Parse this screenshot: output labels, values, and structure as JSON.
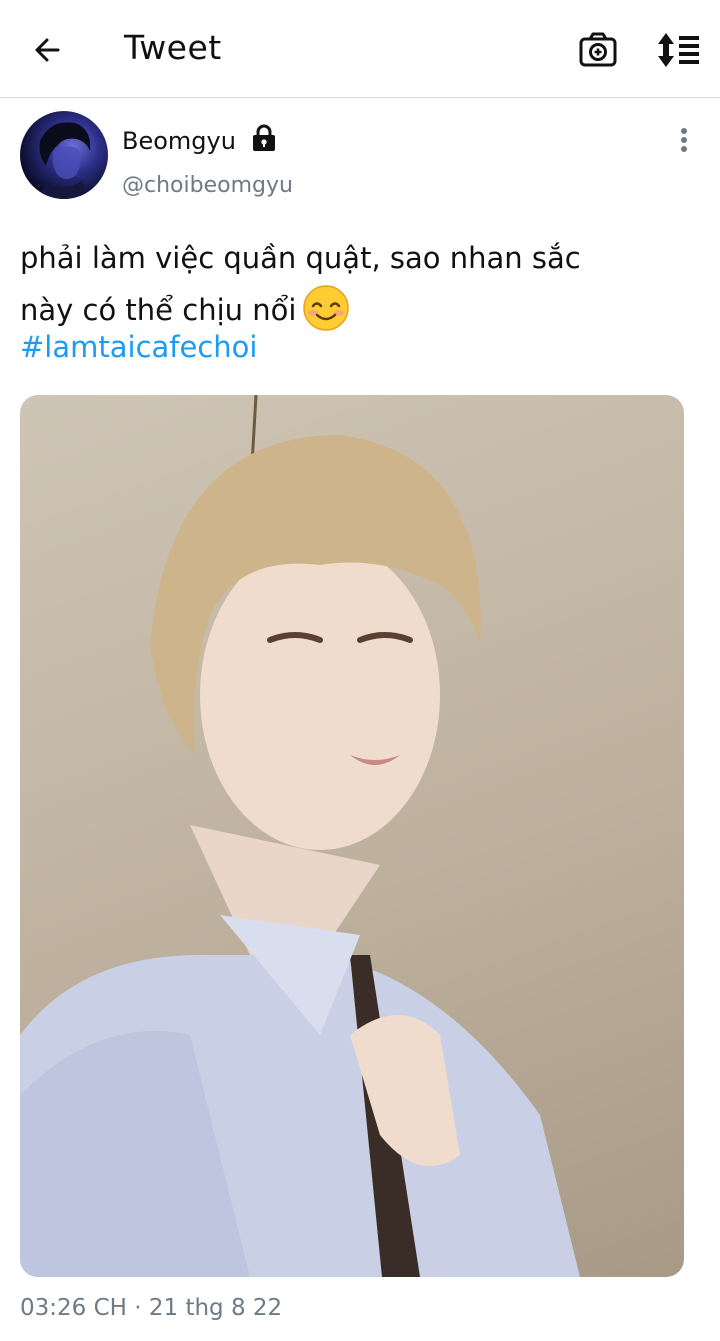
{
  "header": {
    "title": "Tweet",
    "icons": {
      "back": "arrow-left-icon",
      "camera": "camera-plus-icon",
      "sort": "sort-icon"
    }
  },
  "tweet": {
    "author_name": "Beomgyu",
    "author_handle": "@choibeomgyu",
    "text_line1": "phải làm việc quần quật,  sao nhan sắc",
    "text_line2": "này có thể chịu nổi",
    "hashtag": "#lamtaicafechoi",
    "timestamp": "03:26 CH · 21 thg 8 22",
    "icons": {
      "lock": "lock-icon",
      "more": "more-vertical-icon",
      "emoji": "smiling-face-emoji-icon"
    }
  },
  "colors": {
    "link": "#1d9bf0",
    "secondary_text": "#6e7a86",
    "divider": "#dadada"
  }
}
